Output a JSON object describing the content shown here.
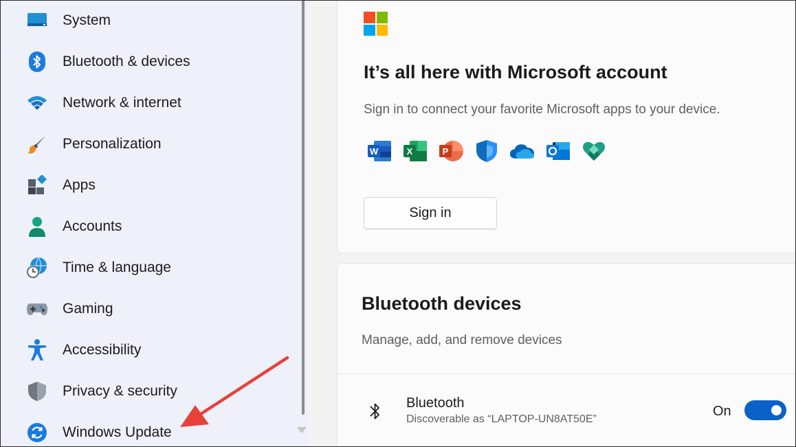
{
  "sidebar": {
    "items": [
      {
        "label": "System",
        "icon": "system-icon"
      },
      {
        "label": "Bluetooth & devices",
        "icon": "bluetooth-icon"
      },
      {
        "label": "Network & internet",
        "icon": "wifi-icon"
      },
      {
        "label": "Personalization",
        "icon": "paintbrush-icon"
      },
      {
        "label": "Apps",
        "icon": "apps-icon"
      },
      {
        "label": "Accounts",
        "icon": "person-icon"
      },
      {
        "label": "Time & language",
        "icon": "globe-clock-icon"
      },
      {
        "label": "Gaming",
        "icon": "gamepad-icon"
      },
      {
        "label": "Accessibility",
        "icon": "accessibility-icon"
      },
      {
        "label": "Privacy & security",
        "icon": "shield-icon"
      },
      {
        "label": "Windows Update",
        "icon": "refresh-icon"
      }
    ]
  },
  "microsoft_account": {
    "title": "It’s all here with Microsoft account",
    "subtitle": "Sign in to connect your favorite Microsoft apps to your device.",
    "apps": [
      "word-icon",
      "excel-icon",
      "powerpoint-icon",
      "defender-icon",
      "onedrive-icon",
      "outlook-icon",
      "family-safety-icon"
    ],
    "signin_label": "Sign in"
  },
  "bluetooth_devices": {
    "title": "Bluetooth devices",
    "subtitle": "Manage, add, and remove devices",
    "bluetooth_row": {
      "name": "Bluetooth",
      "description": "Discoverable as “LAPTOP-UN8AT50E”",
      "state_label": "On"
    }
  },
  "colors": {
    "accent": "#0a62c9",
    "annotation_arrow": "#e8413b",
    "ms_red": "#f25022",
    "ms_green": "#7fba00",
    "ms_blue": "#00a4ef",
    "ms_yellow": "#ffb900"
  }
}
